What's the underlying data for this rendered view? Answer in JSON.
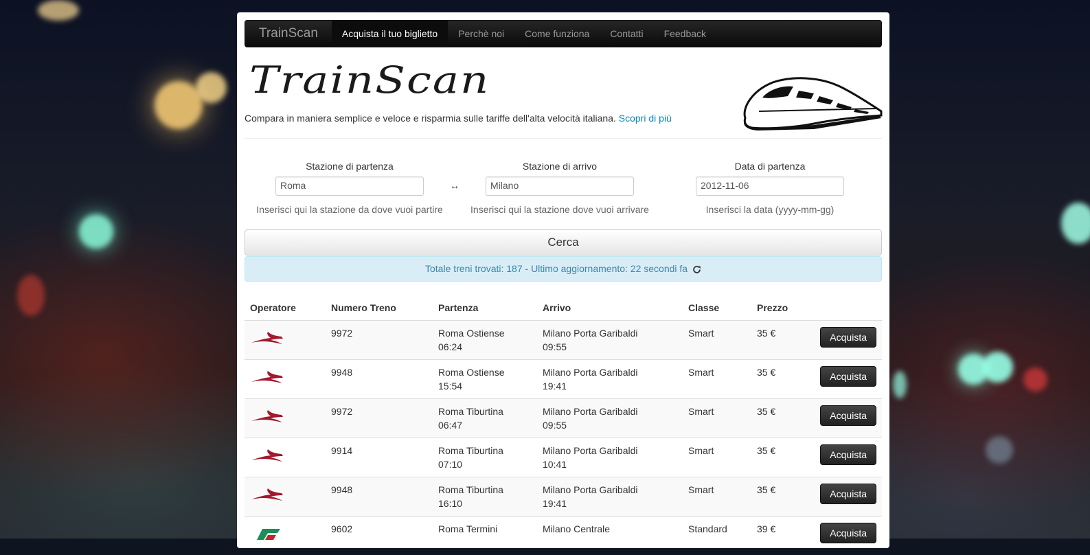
{
  "navbar": {
    "brand": "TrainScan",
    "items": [
      {
        "label": "Acquista il tuo biglietto",
        "active": true
      },
      {
        "label": "Perchè noi",
        "active": false
      },
      {
        "label": "Come funziona",
        "active": false
      },
      {
        "label": "Contatti",
        "active": false
      },
      {
        "label": "Feedback",
        "active": false
      }
    ]
  },
  "hero": {
    "logo": "TrainScan",
    "tagline": "Compara in maniera semplice e veloce e risparmia sulle tariffe dell'alta velocità italiana.",
    "link": "Scopri di più"
  },
  "form": {
    "departure": {
      "label": "Stazione di partenza",
      "value": "Roma",
      "help": "Inserisci qui la stazione da dove vuoi partire"
    },
    "arrival": {
      "label": "Stazione di arrivo",
      "value": "Milano",
      "help": "Inserisci qui la stazione dove vuoi arrivare"
    },
    "date": {
      "label": "Data di partenza",
      "value": "2012-11-06",
      "help": "Inserisci la data (yyyy-mm-gg)"
    },
    "swap_symbol": "↔",
    "search_label": "Cerca"
  },
  "status": {
    "text": "Totale treni trovati: 187 - Ultimo aggiornamento: 22 secondi fa"
  },
  "table": {
    "headers": [
      "Operatore",
      "Numero Treno",
      "Partenza",
      "Arrivo",
      "Classe",
      "Prezzo",
      ""
    ],
    "rows": [
      {
        "operator": "italo",
        "number": "9972",
        "dep_station": "Roma Ostiense",
        "dep_time": "06:24",
        "arr_station": "Milano Porta Garibaldi",
        "arr_time": "09:55",
        "class": "Smart",
        "price": "35 €",
        "buy": "Acquista"
      },
      {
        "operator": "italo",
        "number": "9948",
        "dep_station": "Roma Ostiense",
        "dep_time": "15:54",
        "arr_station": "Milano Porta Garibaldi",
        "arr_time": "19:41",
        "class": "Smart",
        "price": "35 €",
        "buy": "Acquista"
      },
      {
        "operator": "italo",
        "number": "9972",
        "dep_station": "Roma Tiburtina",
        "dep_time": "06:47",
        "arr_station": "Milano Porta Garibaldi",
        "arr_time": "09:55",
        "class": "Smart",
        "price": "35 €",
        "buy": "Acquista"
      },
      {
        "operator": "italo",
        "number": "9914",
        "dep_station": "Roma Tiburtina",
        "dep_time": "07:10",
        "arr_station": "Milano Porta Garibaldi",
        "arr_time": "10:41",
        "class": "Smart",
        "price": "35 €",
        "buy": "Acquista"
      },
      {
        "operator": "italo",
        "number": "9948",
        "dep_station": "Roma Tiburtina",
        "dep_time": "16:10",
        "arr_station": "Milano Porta Garibaldi",
        "arr_time": "19:41",
        "class": "Smart",
        "price": "35 €",
        "buy": "Acquista"
      },
      {
        "operator": "trenitalia",
        "number": "9602",
        "dep_station": "Roma Termini",
        "dep_time": "",
        "arr_station": "Milano Centrale",
        "arr_time": "",
        "class": "Standard",
        "price": "39 €",
        "buy": "Acquista"
      }
    ]
  },
  "colors": {
    "italo_red": "#a3182e",
    "trenitalia_green": "#1a8f5a",
    "link_blue": "#0088cc"
  }
}
